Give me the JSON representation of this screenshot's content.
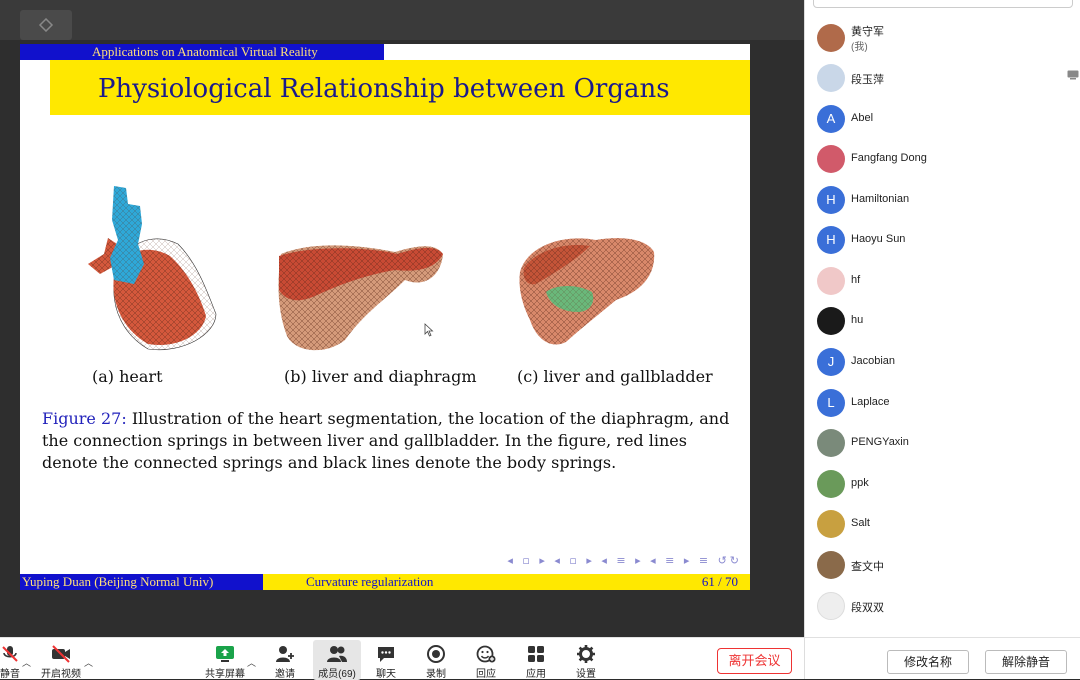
{
  "slide": {
    "section": "Applications on Anatomical Virtual Reality",
    "title": "Physiological Relationship between Organs",
    "subfigures": [
      {
        "caption": "(a) heart"
      },
      {
        "caption": "(b) liver and diaphragm"
      },
      {
        "caption": "(c) liver and gallbladder"
      }
    ],
    "figure_label": "Figure 27:",
    "figure_text": "Illustration of the heart segmentation, the location of the diaphragm, and the connection springs in between liver and gallbladder. In the figure, red lines denote the connected springs and black lines denote the body springs.",
    "footer": {
      "author": "Yuping Duan (Beijing Normal Univ)",
      "talk": "Curvature regularization",
      "page": "61 / 70"
    },
    "nav_icons": "◂ ▫ ▸ ◂ ▫ ▸ ◂ ≡ ▸ ◂ ≡ ▸ ≡ ↺↻"
  },
  "members": [
    {
      "name": "黄守军",
      "sub": "(我)",
      "avatar": "photo",
      "color": "#b06a4a"
    },
    {
      "name": "段玉萍",
      "avatar": "photo",
      "color": "#c9d7e8",
      "icon": "screen-share-icon"
    },
    {
      "name": "Abel",
      "avatar": "letter",
      "letter": "A",
      "color": "#3a6fd8"
    },
    {
      "name": "Fangfang Dong",
      "avatar": "photo",
      "color": "#d15a6a"
    },
    {
      "name": "Hamiltonian",
      "avatar": "letter",
      "letter": "H",
      "color": "#3a6fd8"
    },
    {
      "name": "Haoyu Sun",
      "avatar": "letter",
      "letter": "H",
      "color": "#3a6fd8"
    },
    {
      "name": "hf",
      "avatar": "photo",
      "color": "#f0c8c8"
    },
    {
      "name": "hu",
      "avatar": "photo",
      "color": "#1a1a1a"
    },
    {
      "name": "Jacobian",
      "avatar": "letter",
      "letter": "J",
      "color": "#3a6fd8"
    },
    {
      "name": "Laplace",
      "avatar": "letter",
      "letter": "L",
      "color": "#3a6fd8"
    },
    {
      "name": "PENGYaxin",
      "avatar": "photo",
      "color": "#7a8a7a"
    },
    {
      "name": "ppk",
      "avatar": "photo",
      "color": "#6a9a5a"
    },
    {
      "name": "Salt",
      "avatar": "photo",
      "color": "#c8a040"
    },
    {
      "name": "查文中",
      "avatar": "photo",
      "color": "#8a6a4a"
    },
    {
      "name": "段双双",
      "avatar": "photo",
      "color": "#eeeeee"
    }
  ],
  "side_buttons": {
    "rename": "修改名称",
    "unmute": "解除静音"
  },
  "toolbar": {
    "mute": "静音",
    "video": "开启视频",
    "share": "共享屏幕",
    "invite": "邀请",
    "members": "成员(69)",
    "chat": "聊天",
    "record": "录制",
    "react": "回应",
    "apps": "应用",
    "settings": "设置",
    "leave": "离开会议"
  },
  "colors": {
    "beamer_blue": "#1111cc",
    "beamer_yellow": "#ffe800",
    "leave_red": "#e33333",
    "share_green": "#1aa34a"
  }
}
